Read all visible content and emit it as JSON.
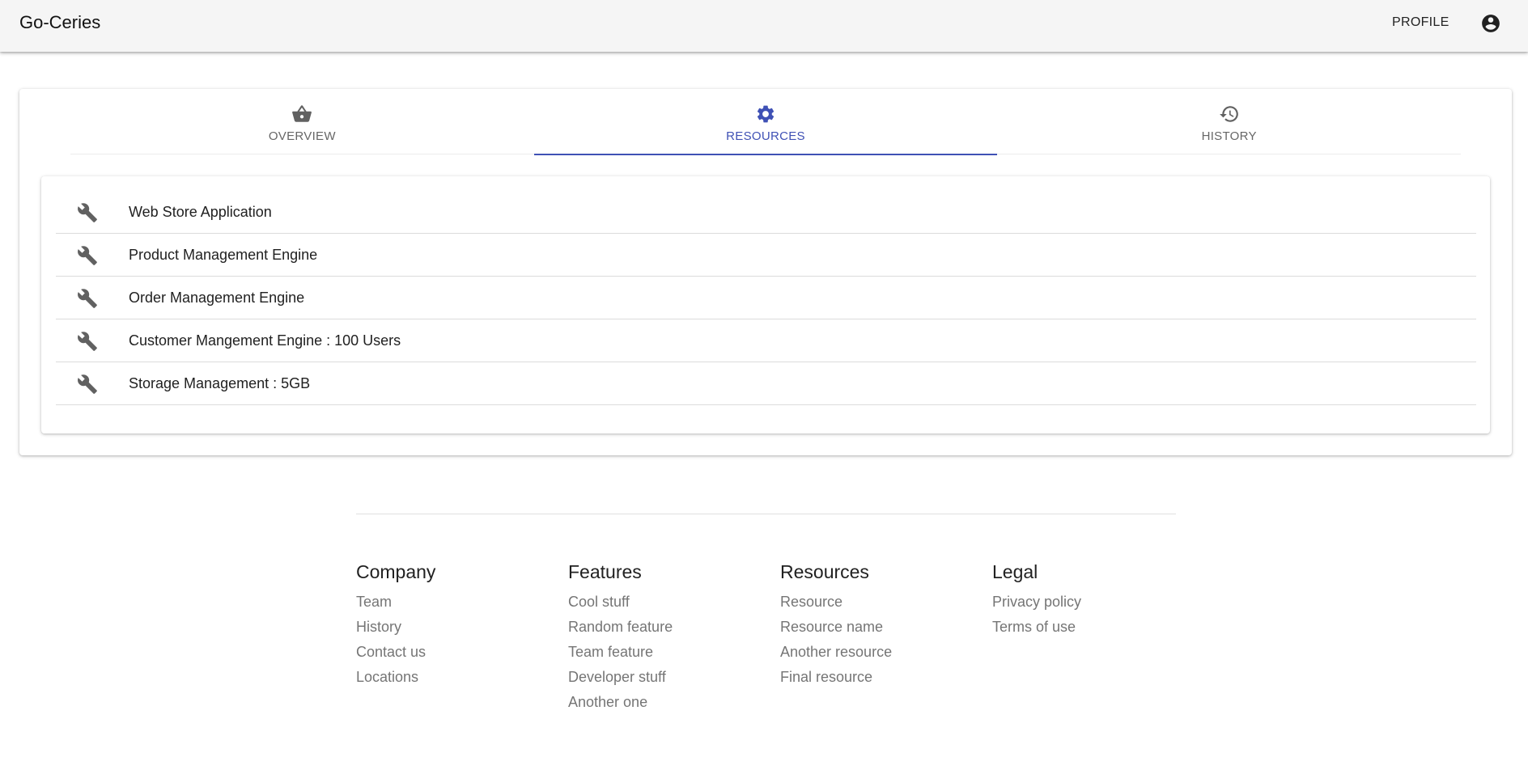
{
  "header": {
    "brand": "Go-Ceries",
    "profile_label": "PROFILE",
    "account_icon": "account-circle-icon"
  },
  "tabs": [
    {
      "label": "OVERVIEW",
      "icon": "basket-icon",
      "active": false
    },
    {
      "label": "RESOURCES",
      "icon": "gear-icon",
      "active": true
    },
    {
      "label": "HISTORY",
      "icon": "history-icon",
      "active": false
    }
  ],
  "resources": [
    {
      "text": "Web Store Application",
      "icon": "wrench-icon"
    },
    {
      "text": "Product Management Engine",
      "icon": "wrench-icon"
    },
    {
      "text": "Order Management Engine",
      "icon": "wrench-icon"
    },
    {
      "text": "Customer Mangement Engine : 100 Users",
      "icon": "wrench-icon"
    },
    {
      "text": "Storage Management : 5GB",
      "icon": "wrench-icon"
    }
  ],
  "footer": {
    "company": {
      "title": "Company",
      "links": [
        "Team",
        "History",
        "Contact us",
        "Locations"
      ]
    },
    "features": {
      "title": "Features",
      "links": [
        "Cool stuff",
        "Random feature",
        "Team feature",
        "Developer stuff",
        "Another one"
      ]
    },
    "resources": {
      "title": "Resources",
      "links": [
        "Resource",
        "Resource name",
        "Another resource",
        "Final resource"
      ]
    },
    "legal": {
      "title": "Legal",
      "links": [
        "Privacy policy",
        "Terms of use"
      ]
    }
  },
  "colors": {
    "accent": "#3f51b5",
    "app_bar": "#f5f5f5",
    "icon_grey": "#616161"
  }
}
